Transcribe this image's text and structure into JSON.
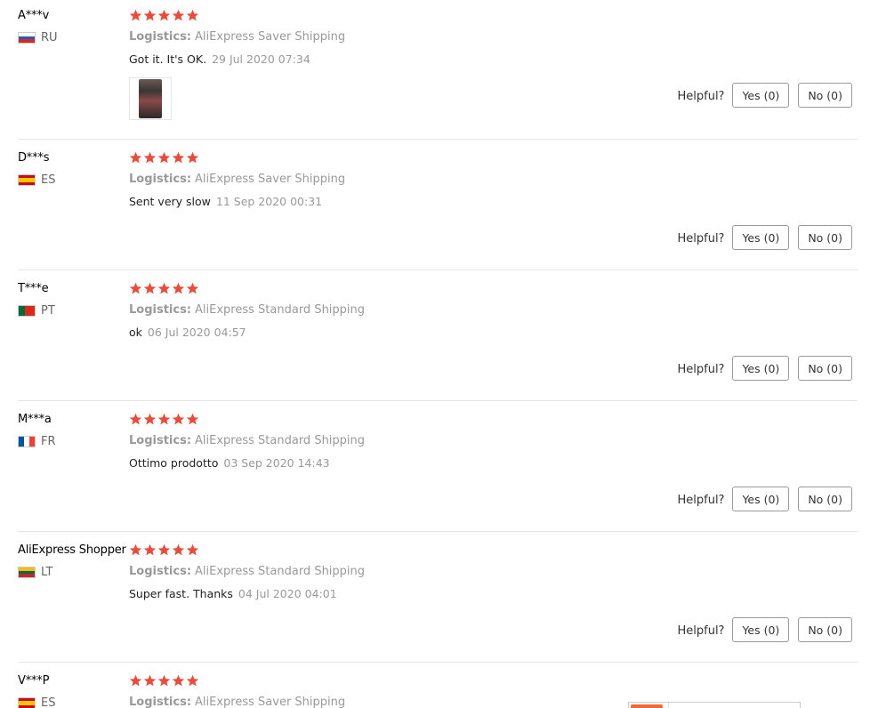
{
  "reviews": [
    {
      "user": "A***v",
      "country": "RU",
      "flag": [
        "#ffffff",
        "#2a5ab8",
        "#d52b1e"
      ],
      "stars": 5,
      "logistics_label": "Logistics:",
      "logistics": "AliExpress Saver Shipping",
      "text": "Got it. It's OK.",
      "date": "29 Jul 2020 07:34",
      "has_image": true,
      "helpful_label": "Helpful?",
      "yes_label": "Yes (0)",
      "no_label": "No (0)"
    },
    {
      "user": "D***s",
      "country": "ES",
      "flag": [
        "#c60b1e",
        "#ffc400",
        "#c60b1e"
      ],
      "stars": 5,
      "logistics_label": "Logistics:",
      "logistics": "AliExpress Saver Shipping",
      "text": "Sent very slow",
      "date": "11 Sep 2020 00:31",
      "has_image": false,
      "helpful_label": "Helpful?",
      "yes_label": "Yes (0)",
      "no_label": "No (0)"
    },
    {
      "user": "T***e",
      "country": "PT",
      "flag": [
        "#046a38",
        "#da291c"
      ],
      "stars": 5,
      "logistics_label": "Logistics:",
      "logistics": "AliExpress Standard Shipping",
      "text": "ok",
      "date": "06 Jul 2020 04:57",
      "has_image": false,
      "helpful_label": "Helpful?",
      "yes_label": "Yes (0)",
      "no_label": "No (0)"
    },
    {
      "user": "M***a",
      "country": "FR",
      "flag": [
        "#0055a4",
        "#ffffff",
        "#ef4135"
      ],
      "stars": 5,
      "logistics_label": "Logistics:",
      "logistics": "AliExpress Standard Shipping",
      "text": "Ottimo prodotto",
      "date": "03 Sep 2020 14:43",
      "has_image": false,
      "helpful_label": "Helpful?",
      "yes_label": "Yes (0)",
      "no_label": "No (0)"
    },
    {
      "user": "AliExpress Shopper",
      "country": "LT",
      "flag": [
        "#fdb913",
        "#006a44",
        "#c1272d"
      ],
      "stars": 5,
      "logistics_label": "Logistics:",
      "logistics": "AliExpress Standard Shipping",
      "text": "Super fast. Thanks",
      "date": "04 Jul 2020 04:01",
      "has_image": false,
      "helpful_label": "Helpful?",
      "yes_label": "Yes (0)",
      "no_label": "No (0)"
    },
    {
      "user": "V***P",
      "country": "ES",
      "flag": [
        "#c60b1e",
        "#ffc400",
        "#c60b1e"
      ],
      "stars": 5,
      "logistics_label": "Logistics:",
      "logistics": "AliExpress Saver Shipping",
      "text": "",
      "date": "",
      "has_image": false,
      "helpful_label": "",
      "yes_label": "",
      "no_label": ""
    }
  ],
  "colors": {
    "star": "#e74c3c",
    "muted_text": "#999999",
    "divider": "#e6e6e6",
    "button_border": "#999999"
  }
}
